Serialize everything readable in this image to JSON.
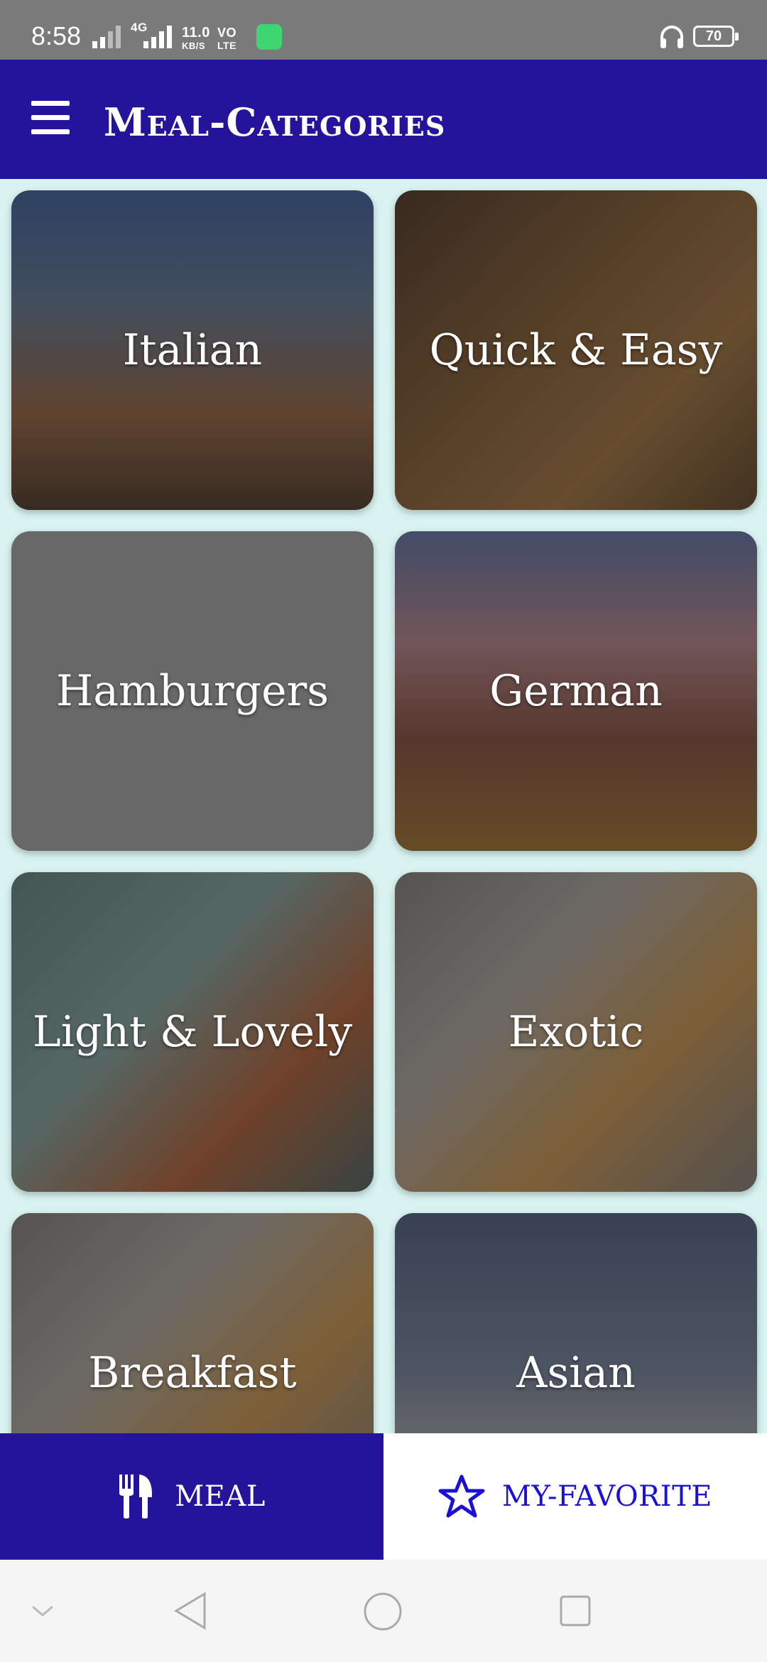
{
  "status_bar": {
    "time": "8:58",
    "net_speed": "11.0",
    "net_unit": "KB/S",
    "volte_top": "VO",
    "volte_bottom": "LTE",
    "net_type": "4G",
    "battery": "70"
  },
  "app_bar": {
    "title": "Meal-Categories",
    "menu_icon": "hamburger-menu-icon"
  },
  "categories": [
    {
      "label": "Italian",
      "color": "#5a6e8a"
    },
    {
      "label": "Quick & Easy",
      "color": "#6b4a2e"
    },
    {
      "label": "Hamburgers",
      "color": "#6a6a6a"
    },
    {
      "label": "German",
      "color": "#5b5a78"
    },
    {
      "label": "Light & Lovely",
      "color": "#4e6466"
    },
    {
      "label": "Exotic",
      "color": "#67605a"
    },
    {
      "label": "Breakfast",
      "color": "#67605a"
    },
    {
      "label": "Asian",
      "color": "#44536a"
    }
  ],
  "bottom_nav": {
    "meal": {
      "label": "MEAL",
      "icon": "fork-knife-icon"
    },
    "favorite": {
      "label": "MY-FAVORITE",
      "icon": "star-outline-icon"
    }
  },
  "colors": {
    "primary": "#23149b",
    "accent": "#1a10d8",
    "background": "#d8f3f0"
  }
}
